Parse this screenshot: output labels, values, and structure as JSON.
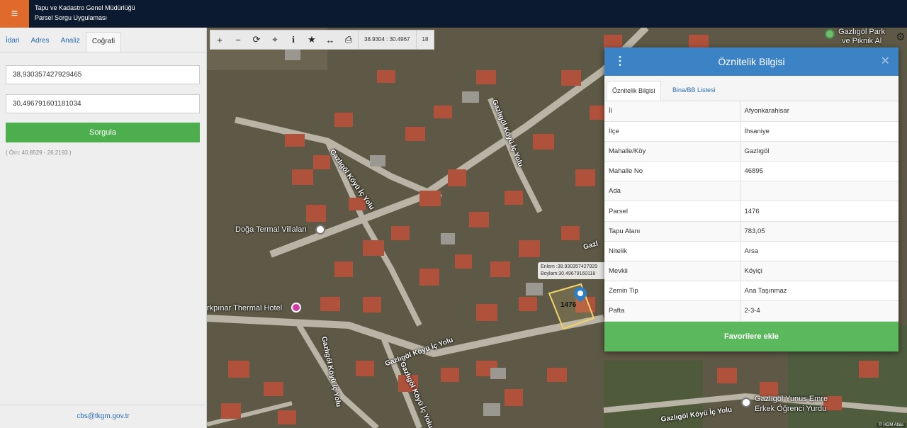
{
  "header": {
    "menu_icon": "hamburger-icon",
    "title_line1": "Tapu ve Kadastro Genel Müdürlüğü",
    "title_line2": "Parsel Sorgu Uygulaması"
  },
  "sidebar": {
    "tabs": [
      {
        "label": "İdari",
        "active": false
      },
      {
        "label": "Adres",
        "active": false
      },
      {
        "label": "Analiz",
        "active": false
      },
      {
        "label": "Coğrafi",
        "active": true
      }
    ],
    "lat_value": "38,930357427929465",
    "lon_value": "30,496791601181034",
    "query_label": "Sorgula",
    "coord_note": "( Örn: 40,8529 - 26,2193 )",
    "footer_email": "cbs@tkgm.gov.tr"
  },
  "map": {
    "toolbar": {
      "icons": [
        "zoom-in-icon",
        "zoom-out-icon",
        "refresh-icon",
        "locate-icon",
        "info-icon",
        "favorite-icon",
        "measure-icon",
        "print-icon"
      ],
      "coords": "38.9304 : 30.4967",
      "zoom": "18"
    },
    "labels": {
      "doga": "Doğa Termal Villaları",
      "thermal": "rkpınar Thermal Hotel",
      "park": "Gazlıgöl Park",
      "park2": "ve Piknik Al",
      "yurdu1": "Gazlıgöl Yunus Emre",
      "yurdu2": "Erkek Öğrenci Yurdu",
      "road1": "Gazlıgöl Köyü İç Yolu",
      "road2": "Gazlıgöl Köyü İç Yolu",
      "road3": "Gazlıgöl Köyü İç Yolu",
      "road4": "Gazlıgöl Köyü İç Yolu",
      "road5": "Gazlıgöl Köyü İç Yolu",
      "road6": "Gazlıgöl Köyü İç Yolu",
      "road7": "Gazl"
    },
    "tooltip_lat": "Enlem  :38.930357427929",
    "tooltip_lon": "Boylam:30.49679160118",
    "parcel_label": "1476",
    "attribution": "© HGM Atlas"
  },
  "dialog": {
    "title": "Öznitelik Bilgisi",
    "tab_active": "Öznitelik Bilgisi",
    "tab_other": "Bina/BB Listesi",
    "rows": [
      {
        "key": "İl",
        "value": "Afyonkarahisar"
      },
      {
        "key": "İlçe",
        "value": "İhsaniye"
      },
      {
        "key": "Mahalle/Köy",
        "value": "Gazlıgöl"
      },
      {
        "key": "Mahalle No",
        "value": "46895"
      },
      {
        "key": "Ada",
        "value": ""
      },
      {
        "key": "Parsel",
        "value": "1476"
      },
      {
        "key": "Tapu Alanı",
        "value": "783,05"
      },
      {
        "key": "Nitelik",
        "value": "Arsa"
      },
      {
        "key": "Mevkii",
        "value": "Köyiçi"
      },
      {
        "key": "Zemin Tip",
        "value": "Ana Taşınmaz"
      },
      {
        "key": "Pafta",
        "value": "2-3-4"
      }
    ],
    "favorite_label": "Favorilere ekle"
  },
  "colors": {
    "header_bg": "#0b1a2e",
    "menu_bg": "#e06a2b",
    "query_btn": "#4cae4c",
    "dialog_head": "#3c83c6",
    "favorite_btn": "#5cb85c"
  }
}
